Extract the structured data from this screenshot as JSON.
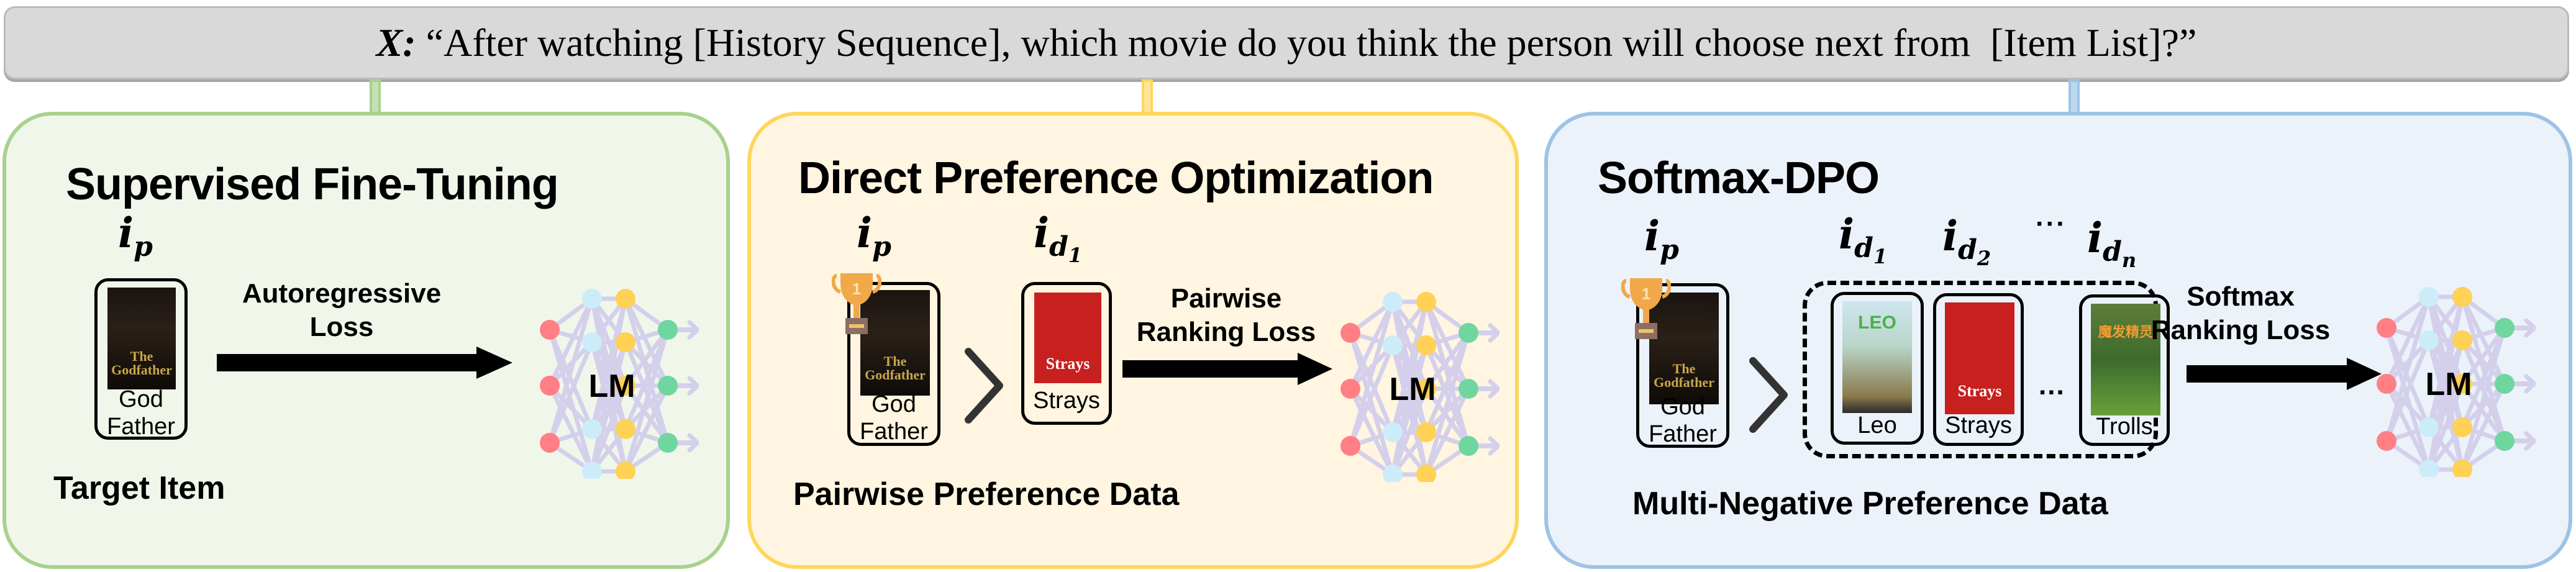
{
  "prompt": {
    "variable": "X:",
    "text": " “After watching [History Sequence], which movie do you think the person will choose next from  [Item List]?”"
  },
  "colors": {
    "sft_border": "#a9d18e",
    "sft_bg": "#f0f7ea",
    "dpo_border": "#ffd65c",
    "dpo_bg": "#fff5e0",
    "sdpo_border": "#9dc3e6",
    "sdpo_bg": "#ebf2fa",
    "node_input": "#ff7f85",
    "node_hidden1": "#ccecf9",
    "node_hidden2": "#ffd154",
    "node_output": "#6fd6a0",
    "edge": "#d4d0eb"
  },
  "panels": {
    "sft": {
      "title": "Supervised Fine-Tuning",
      "positive_symbol": {
        "base": "i",
        "sub": "p"
      },
      "item": {
        "label": "God\nFather",
        "poster": "The Godfather"
      },
      "loss_label": "Autoregressive\nLoss",
      "model_label": "LM",
      "caption": "Target Item"
    },
    "dpo": {
      "title": "Direct Preference Optimization",
      "positive_symbol": {
        "base": "i",
        "sub": "p"
      },
      "negative_symbol": {
        "base": "i",
        "sub": "d",
        "subsub": "1"
      },
      "trophy_rank": "1",
      "positive_item": {
        "label": "God\nFather",
        "poster": "The Godfather"
      },
      "comparator": ">",
      "negative_item": {
        "label": "Strays",
        "poster": "Strays"
      },
      "loss_label": "Pairwise\nRanking Loss",
      "model_label": "LM",
      "caption": "Pairwise Preference Data"
    },
    "sdpo": {
      "title": "Softmax-DPO",
      "positive_symbol": {
        "base": "i",
        "sub": "p"
      },
      "negative_symbols": [
        {
          "base": "i",
          "sub": "d",
          "subsub": "1"
        },
        {
          "base": "i",
          "sub": "d",
          "subsub": "2"
        },
        {
          "base": "i",
          "sub": "d",
          "subsub": "n"
        }
      ],
      "symbol_ellipsis": "···",
      "trophy_rank": "1",
      "positive_item": {
        "label": "God\nFather",
        "poster": "The Godfather"
      },
      "comparator": ">",
      "negative_items": [
        {
          "label": "Leo",
          "poster": "LEO"
        },
        {
          "label": "Strays",
          "poster": "Strays"
        },
        {
          "label": "Trolls",
          "poster": "魔发精灵"
        }
      ],
      "items_ellipsis": "...",
      "loss_label": "Softmax\nRanking Loss",
      "model_label": "LM",
      "caption": "Multi-Negative Preference Data"
    }
  }
}
